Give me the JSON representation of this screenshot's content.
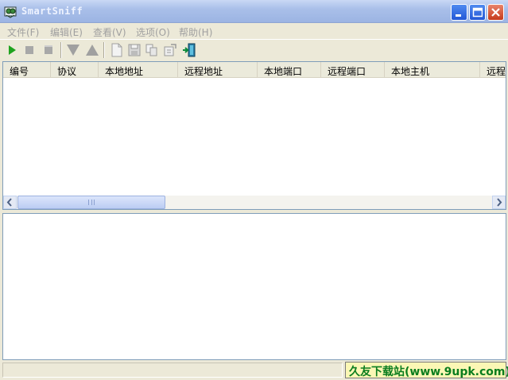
{
  "window": {
    "title": "SmartSniff",
    "icon": "smartsniff-app-icon",
    "controls": [
      "minimize-icon",
      "maximize-icon",
      "close-icon"
    ]
  },
  "menu": [
    {
      "label": "文件(F)"
    },
    {
      "label": "编辑(E)"
    },
    {
      "label": "查看(V)"
    },
    {
      "label": "选项(O)"
    },
    {
      "label": "帮助(H)"
    }
  ],
  "toolbar": [
    {
      "name": "start-capture",
      "icon": "play-icon"
    },
    {
      "name": "stop-capture",
      "icon": "stop-icon"
    },
    {
      "name": "pause-capture",
      "icon": "pause-icon"
    },
    {
      "name": "move-down",
      "icon": "triangle-down-icon"
    },
    {
      "name": "move-up",
      "icon": "triangle-up-icon"
    },
    {
      "name": "new",
      "icon": "blank-page-icon"
    },
    {
      "name": "save",
      "icon": "floppy-disk-icon"
    },
    {
      "name": "copy",
      "icon": "copy-icon"
    },
    {
      "name": "properties",
      "icon": "properties-icon"
    },
    {
      "name": "exit",
      "icon": "exit-door-icon"
    }
  ],
  "list": {
    "columns": [
      "编号",
      "协议",
      "本地地址",
      "远程地址",
      "本地端口",
      "远程端口",
      "本地主机",
      "远程"
    ],
    "rows": []
  },
  "statusbar": {
    "text": "",
    "watermark": "久友下载站(www.9upk.com)"
  },
  "colors": {
    "title_gradient_top": "#c9d8f5",
    "list_border": "#7f9db9",
    "watermark_text": "#0a7d1e",
    "watermark_bg": "#fbf7b5"
  }
}
